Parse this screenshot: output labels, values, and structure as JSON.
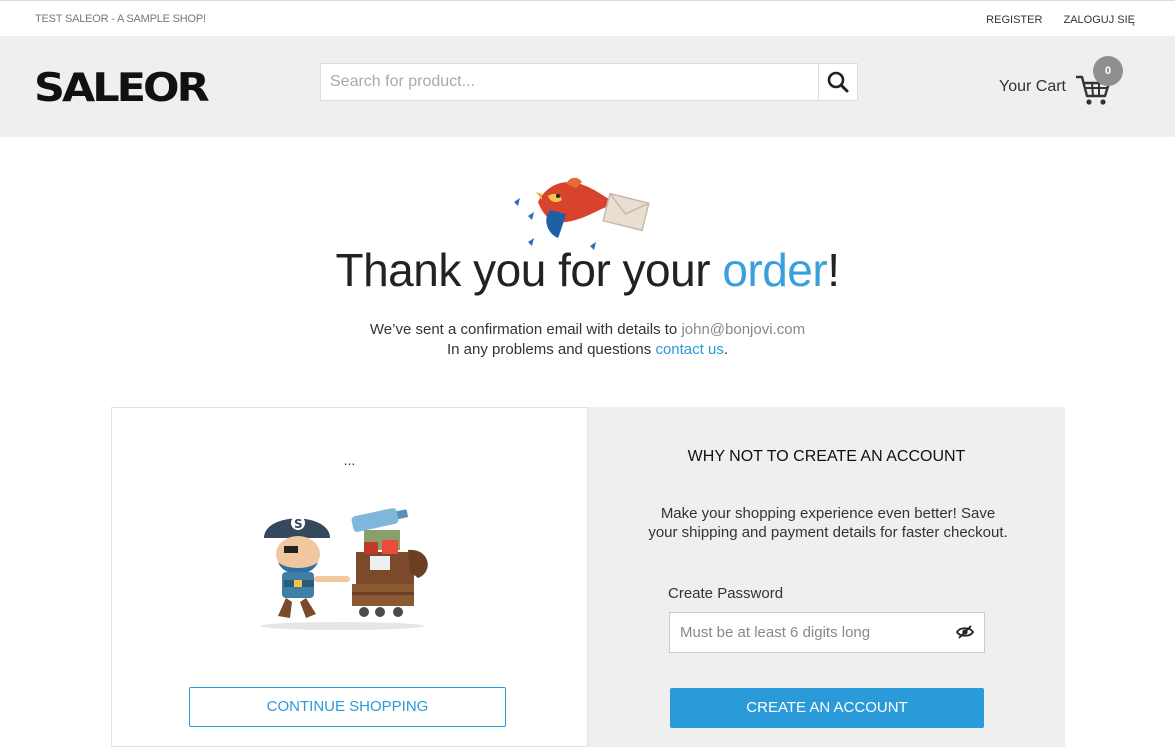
{
  "topbar": {
    "shop_name": "TEST SALEOR - A SAMPLE SHOP!",
    "register_label": "REGISTER",
    "login_label": "ZALOGUJ SIĘ"
  },
  "header": {
    "logo_text": "SALEOR",
    "search_placeholder": "Search for product...",
    "search_icon": "search-icon",
    "cart_label": "Your Cart",
    "cart_icon": "cart-icon",
    "cart_count": "0"
  },
  "confirmation": {
    "title_before": "Thank you for your ",
    "title_accent": "order",
    "title_after": "!",
    "line1_text": "We’ve sent a confirmation email with details to ",
    "email": "john@bonjovi.com",
    "line2_text": "In any problems and questions ",
    "contact_link": "contact us",
    "line2_end": "."
  },
  "left_panel": {
    "dots": "...",
    "continue_label": "CONTINUE SHOPPING"
  },
  "right_panel": {
    "heading": "WHY NOT TO CREATE AN ACCOUNT",
    "description": "Make your shopping experience even better! Save your shipping and payment details for faster checkout.",
    "password_label": "Create Password",
    "password_placeholder": "Must be at least 6 digits long",
    "create_label": "CREATE AN ACCOUNT"
  },
  "colors": {
    "accent": "#2a9ad8",
    "header_bg": "#efefef",
    "badge": "#8f8f8f"
  }
}
